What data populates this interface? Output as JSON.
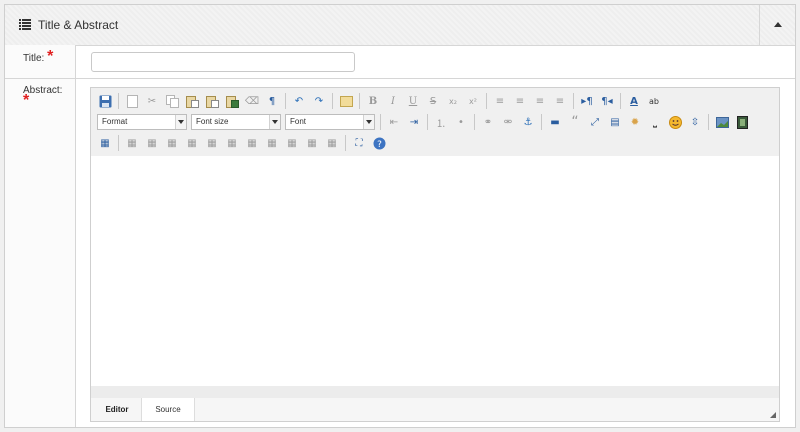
{
  "panel": {
    "title": "Title & Abstract"
  },
  "icons": {
    "header": "list-icon",
    "collapse": "caret-up-icon",
    "resize": "resize-grip-icon"
  },
  "fields": {
    "title": {
      "label": "Title:",
      "required_mark": "*",
      "value": "",
      "placeholder": ""
    },
    "abstract": {
      "label": "Abstract:",
      "required_mark": "*"
    }
  },
  "toolbar": {
    "format": "Format",
    "font_size": "Font size",
    "font": "Font",
    "glyphs": {
      "bold": "B",
      "italic": "I",
      "underline": "U",
      "strike": "S",
      "subscript": "x₂",
      "superscript": "x²",
      "paragraph": "¶",
      "quote": "“"
    }
  },
  "tabs": {
    "editor": "Editor",
    "source": "Source"
  },
  "colors": {
    "required": "#e02020",
    "accent": "#2a5d9f"
  }
}
